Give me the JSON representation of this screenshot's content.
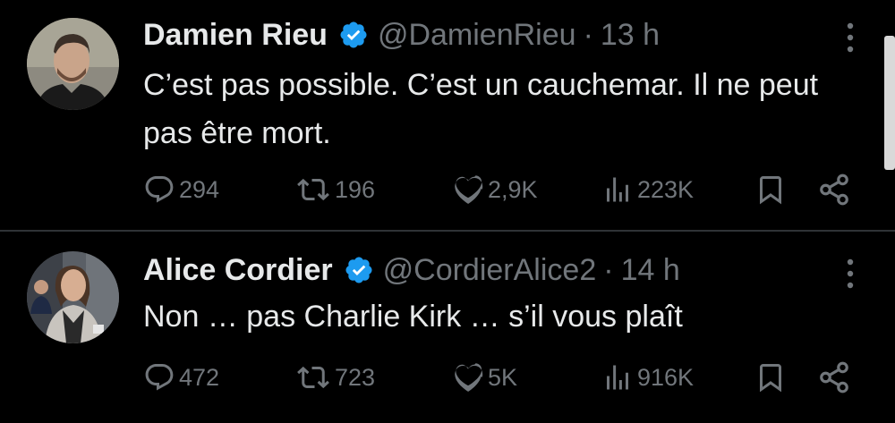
{
  "tweets": [
    {
      "display_name": "Damien Rieu",
      "handle": "@DamienRieu",
      "separator": "·",
      "time": "13 h",
      "text": "C’est pas possible. C’est un cauchemar. Il ne peut pas être mort.",
      "reply_count": "294",
      "repost_count": "196",
      "like_count": "2,9K",
      "view_count": "223K"
    },
    {
      "display_name": "Alice Cordier",
      "handle": "@CordierAlice2",
      "separator": "·",
      "time": "14 h",
      "text": "Non … pas Charlie Kirk … s’il vous plaît",
      "reply_count": "472",
      "repost_count": "723",
      "like_count": "5K",
      "view_count": "916K"
    }
  ],
  "icons": {
    "verified": "verified-badge-icon",
    "more": "more-options-icon",
    "reply": "reply-icon",
    "repost": "repost-icon",
    "like": "heart-icon",
    "views": "views-icon",
    "bookmark": "bookmark-icon",
    "share": "share-icon"
  },
  "colors": {
    "background": "#000000",
    "text_primary": "#e7e9ea",
    "text_secondary": "#71767b",
    "verified": "#1d9bf0",
    "divider": "#2f3336"
  }
}
